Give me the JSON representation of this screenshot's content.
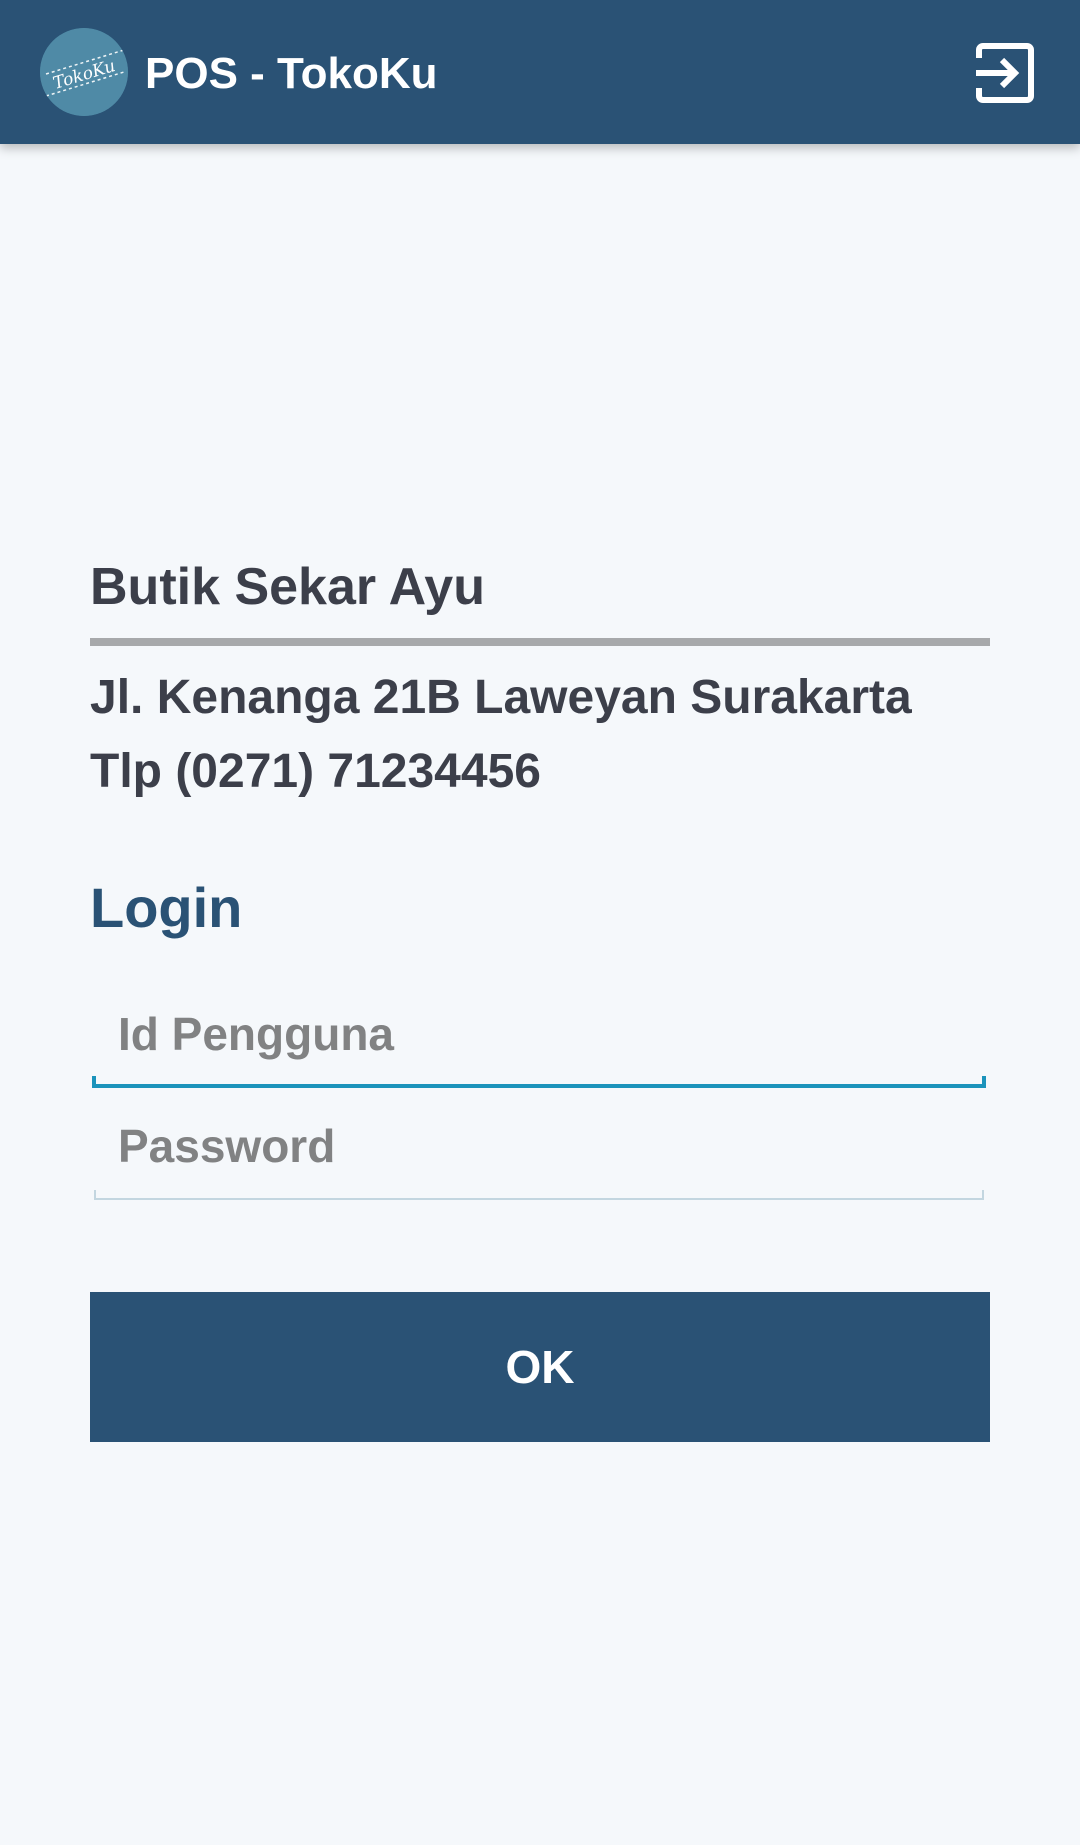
{
  "appbar": {
    "title": "POS - TokoKu",
    "logo_text": "TokoKu",
    "logo_icon": "tokoku-logo",
    "exit_icon": "exit-to-app-icon"
  },
  "shop": {
    "name": "Butik Sekar Ayu",
    "address": "Jl. Kenanga 21B Laweyan Surakarta",
    "phone": "Tlp (0271) 71234456"
  },
  "login": {
    "heading": "Login",
    "user_id_placeholder": "Id Pengguna",
    "user_id_value": "",
    "password_placeholder": "Password",
    "password_value": "",
    "ok_label": "OK"
  },
  "colors": {
    "primary": "#2a5275",
    "accent": "#1b93bb",
    "background": "#f5f8fb",
    "text": "#3c3f4a",
    "hint": "#818283"
  }
}
